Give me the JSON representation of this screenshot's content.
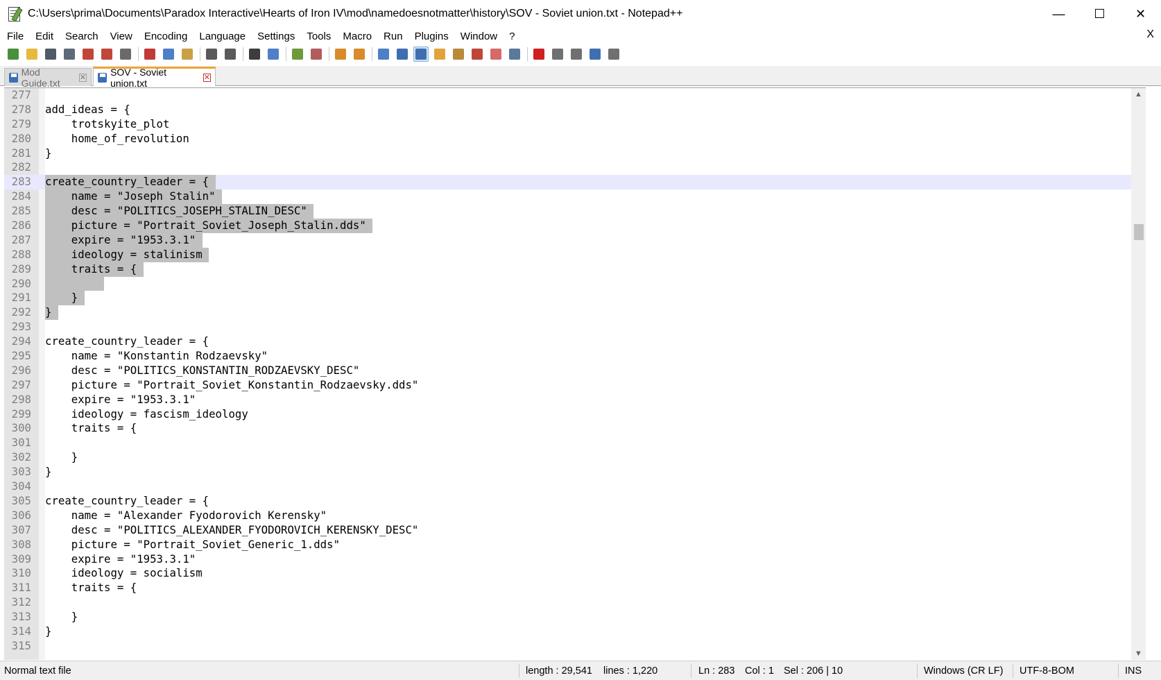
{
  "window": {
    "title": "C:\\Users\\prima\\Documents\\Paradox Interactive\\Hearts of Iron IV\\mod\\namedoesnotmatter\\history\\SOV - Soviet union.txt - Notepad++",
    "controls": {
      "minimize": "—",
      "maximize": "☐",
      "close": "✕"
    }
  },
  "menu": {
    "items": [
      "File",
      "Edit",
      "Search",
      "View",
      "Encoding",
      "Language",
      "Settings",
      "Tools",
      "Macro",
      "Run",
      "Plugins",
      "Window",
      "?"
    ],
    "close": "X"
  },
  "toolbar": {
    "icons": [
      {
        "name": "new-file-icon",
        "color": "#4a8f3c"
      },
      {
        "name": "open-file-icon",
        "color": "#e8b93c"
      },
      {
        "name": "save-icon",
        "color": "#4f5b68"
      },
      {
        "name": "save-all-icon",
        "color": "#5d6b78"
      },
      {
        "name": "close-icon",
        "color": "#c0463a"
      },
      {
        "name": "close-all-icon",
        "color": "#c0463a"
      },
      {
        "name": "print-icon",
        "color": "#6a6a6a"
      },
      {
        "sep": true
      },
      {
        "name": "cut-icon",
        "color": "#c03a3a"
      },
      {
        "name": "copy-icon",
        "color": "#4f7fc6"
      },
      {
        "name": "paste-icon",
        "color": "#c9a046"
      },
      {
        "sep": true
      },
      {
        "name": "undo-icon",
        "color": "#5a5a5a"
      },
      {
        "name": "redo-icon",
        "color": "#5a5a5a"
      },
      {
        "sep": true
      },
      {
        "name": "find-icon",
        "color": "#3d3d3d"
      },
      {
        "name": "replace-icon",
        "color": "#4f7fc6"
      },
      {
        "sep": true
      },
      {
        "name": "zoom-in-icon",
        "color": "#6f9a3a"
      },
      {
        "name": "zoom-out-icon",
        "color": "#b25c5c"
      },
      {
        "sep": true
      },
      {
        "name": "sync-vertical-icon",
        "color": "#d98a2a"
      },
      {
        "name": "sync-horizontal-icon",
        "color": "#d98a2a"
      },
      {
        "sep": true
      },
      {
        "name": "word-wrap-icon",
        "color": "#4f7fc6"
      },
      {
        "name": "show-all-chars-icon",
        "color": "#3f6fb0"
      },
      {
        "name": "indent-guide-icon",
        "color": "#3f6fb0",
        "active": true
      },
      {
        "name": "language-icon",
        "color": "#e3a33c"
      },
      {
        "name": "doc-map-icon",
        "color": "#b88a3a"
      },
      {
        "name": "function-list-icon",
        "color": "#c0463a"
      },
      {
        "name": "folder-workspace-icon",
        "color": "#d56a6a"
      },
      {
        "name": "monitoring-icon",
        "color": "#5a7a9a"
      },
      {
        "sep": true
      },
      {
        "name": "record-macro-icon",
        "color": "#d02020"
      },
      {
        "name": "stop-record-icon",
        "color": "#707070"
      },
      {
        "name": "playback-macro-icon",
        "color": "#707070"
      },
      {
        "name": "run-macro-multiple-icon",
        "color": "#3f6fb0"
      },
      {
        "name": "save-macro-icon",
        "color": "#707070"
      }
    ]
  },
  "tabs": [
    {
      "label": "Mod Guide.txt",
      "active": false,
      "close": "✕"
    },
    {
      "label": "SOV - Soviet union.txt",
      "active": true,
      "close": "✕"
    }
  ],
  "editor": {
    "current_line": 283,
    "lines": [
      {
        "n": "277",
        "text": ""
      },
      {
        "n": "278",
        "text": "add_ideas = {"
      },
      {
        "n": "279",
        "text": "    trotskyite_plot"
      },
      {
        "n": "280",
        "text": "    home_of_revolution"
      },
      {
        "n": "281",
        "text": "}"
      },
      {
        "n": "282",
        "text": ""
      },
      {
        "n": "283",
        "text": "create_country_leader = {",
        "sel": true,
        "current": true
      },
      {
        "n": "284",
        "text": "    name = \"Joseph Stalin\"",
        "sel": true
      },
      {
        "n": "285",
        "text": "    desc = \"POLITICS_JOSEPH_STALIN_DESC\"",
        "sel": true
      },
      {
        "n": "286",
        "text": "    picture = \"Portrait_Soviet_Joseph_Stalin.dds\"",
        "sel": true
      },
      {
        "n": "287",
        "text": "    expire = \"1953.3.1\"",
        "sel": true
      },
      {
        "n": "288",
        "text": "    ideology = stalinism",
        "sel": true
      },
      {
        "n": "289",
        "text": "    traits = {",
        "sel": true
      },
      {
        "n": "290",
        "text": "        ",
        "sel": true
      },
      {
        "n": "291",
        "text": "    }",
        "sel": true
      },
      {
        "n": "292",
        "text": "}",
        "sel": true
      },
      {
        "n": "293",
        "text": ""
      },
      {
        "n": "294",
        "text": "create_country_leader = {"
      },
      {
        "n": "295",
        "text": "    name = \"Konstantin Rodzaevsky\""
      },
      {
        "n": "296",
        "text": "    desc = \"POLITICS_KONSTANTIN_RODZAEVSKY_DESC\""
      },
      {
        "n": "297",
        "text": "    picture = \"Portrait_Soviet_Konstantin_Rodzaevsky.dds\""
      },
      {
        "n": "298",
        "text": "    expire = \"1953.3.1\""
      },
      {
        "n": "299",
        "text": "    ideology = fascism_ideology"
      },
      {
        "n": "300",
        "text": "    traits = {"
      },
      {
        "n": "301",
        "text": ""
      },
      {
        "n": "302",
        "text": "    }"
      },
      {
        "n": "303",
        "text": "}"
      },
      {
        "n": "304",
        "text": ""
      },
      {
        "n": "305",
        "text": "create_country_leader = {"
      },
      {
        "n": "306",
        "text": "    name = \"Alexander Fyodorovich Kerensky\""
      },
      {
        "n": "307",
        "text": "    desc = \"POLITICS_ALEXANDER_FYODOROVICH_KERENSKY_DESC\""
      },
      {
        "n": "308",
        "text": "    picture = \"Portrait_Soviet_Generic_1.dds\""
      },
      {
        "n": "309",
        "text": "    expire = \"1953.3.1\""
      },
      {
        "n": "310",
        "text": "    ideology = socialism"
      },
      {
        "n": "311",
        "text": "    traits = {"
      },
      {
        "n": "312",
        "text": ""
      },
      {
        "n": "313",
        "text": "    }"
      },
      {
        "n": "314",
        "text": "}"
      },
      {
        "n": "315",
        "text": ""
      }
    ],
    "scroll": {
      "up": "▲",
      "down": "▼"
    }
  },
  "status": {
    "file_type": "Normal text file",
    "length": "length : 29,541",
    "lines": "lines : 1,220",
    "ln": "Ln : 283",
    "col": "Col : 1",
    "sel": "Sel : 206 | 10",
    "eol": "Windows (CR LF)",
    "encoding": "UTF-8-BOM",
    "mode": "INS"
  }
}
